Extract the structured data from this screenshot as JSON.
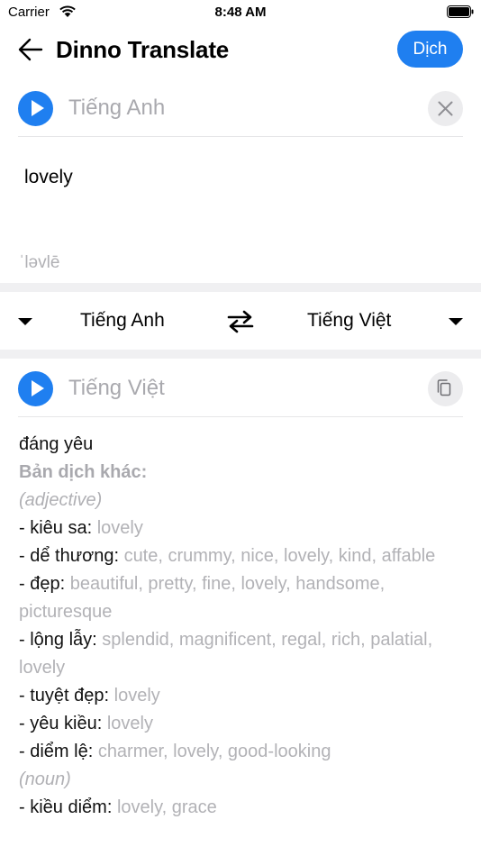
{
  "status": {
    "carrier": "Carrier",
    "time": "8:48 AM"
  },
  "nav": {
    "title": "Dinno Translate",
    "translate_button": "Dịch"
  },
  "source": {
    "language": "Tiếng Anh",
    "text": "lovely",
    "phonetic": "ˈləvlē"
  },
  "language_bar": {
    "from": "Tiếng Anh",
    "to": "Tiếng Việt"
  },
  "target": {
    "language": "Tiếng Việt",
    "main_translation": "đáng yêu",
    "other_label": "Bản dịch khác:",
    "groups": [
      {
        "pos": "(adjective)",
        "items": [
          {
            "term": "- kiêu sa: ",
            "synonyms": "lovely"
          },
          {
            "term": "- dể thương: ",
            "synonyms": "cute, crummy, nice, lovely, kind, affable"
          },
          {
            "term": "- đẹp: ",
            "synonyms": "beautiful, pretty, fine, lovely, handsome, picturesque"
          },
          {
            "term": "- lộng lẫy: ",
            "synonyms": "splendid, magnificent, regal, rich, palatial, lovely"
          },
          {
            "term": "- tuyệt đẹp: ",
            "synonyms": "lovely"
          },
          {
            "term": "- yêu kiều: ",
            "synonyms": "lovely"
          },
          {
            "term": "- diểm lệ: ",
            "synonyms": "charmer, lovely, good-looking"
          }
        ]
      },
      {
        "pos": "(noun)",
        "items": [
          {
            "term": "- kiều diểm: ",
            "synonyms": "lovely, grace"
          }
        ]
      }
    ]
  },
  "colors": {
    "accent": "#1f7ff0",
    "muted": "#a9a9ae",
    "band": "#f0f0f2"
  },
  "icons": [
    "wifi-icon",
    "battery-icon",
    "back-arrow-icon",
    "play-icon",
    "close-icon",
    "copy-icon",
    "caret-down-icon",
    "swap-icon"
  ]
}
